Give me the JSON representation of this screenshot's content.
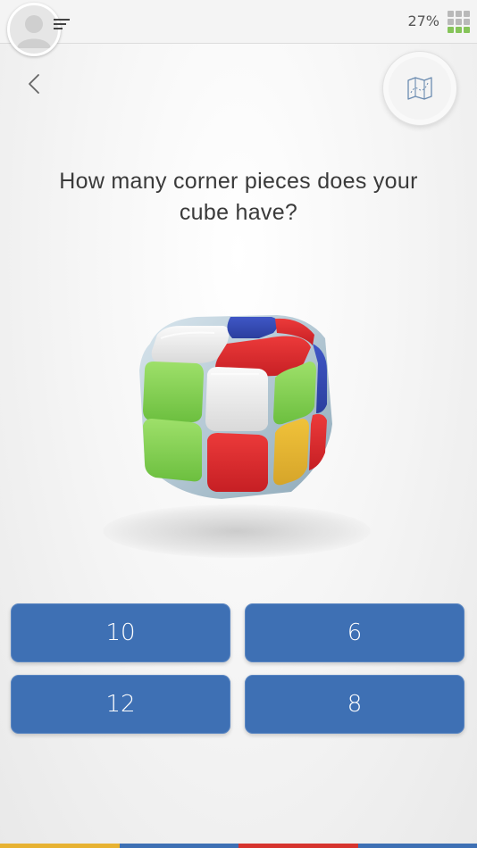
{
  "status": {
    "progress_label": "27%"
  },
  "icons": {
    "avatar": "user-avatar-icon",
    "menu": "menu-icon",
    "grid": "grid-icon",
    "back": "chevron-left-icon",
    "map": "map-icon"
  },
  "question": {
    "text": "How many corner pieces does your cube have?"
  },
  "answers": [
    {
      "label": "10"
    },
    {
      "label": "6"
    },
    {
      "label": "12"
    },
    {
      "label": "8"
    }
  ],
  "colors": {
    "answer_button": "#3e70b4",
    "bottom_strip": [
      "#e7b232",
      "#3e70b4",
      "#d6342e",
      "#3e70b4"
    ]
  }
}
